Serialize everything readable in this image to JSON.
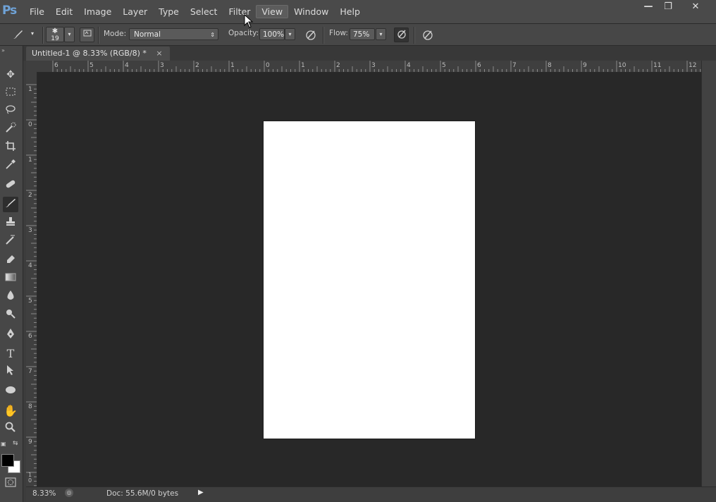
{
  "app": {
    "logo": "Ps"
  },
  "menu": [
    "File",
    "Edit",
    "Image",
    "Layer",
    "Type",
    "Select",
    "Filter",
    "View",
    "Window",
    "Help"
  ],
  "active_menu": "View",
  "window_controls": [
    "—",
    "❐",
    "✕"
  ],
  "options": {
    "brush_size": "19",
    "mode_label": "Mode:",
    "mode_value": "Normal",
    "opacity_label": "Opacity:",
    "opacity_value": "100%",
    "flow_label": "Flow:",
    "flow_value": "75%"
  },
  "document_tab": {
    "title": "Untitled-1 @ 8.33% (RGB/8) *",
    "close": "×"
  },
  "ruler_top_labels": [
    "6",
    "5",
    "4",
    "3",
    "2",
    "1",
    "0",
    "1",
    "2",
    "3",
    "4",
    "5",
    "6",
    "7",
    "8",
    "9",
    "10",
    "11",
    "12"
  ],
  "ruler_left_labels": [
    "1",
    "0",
    "1",
    "2",
    "3",
    "4",
    "5",
    "6",
    "7",
    "8",
    "9",
    "1 0"
  ],
  "status": {
    "zoom": "8.33%",
    "doc_info": "Doc: 55.6M/0 bytes"
  },
  "colors": {
    "foreground": "#000000",
    "background": "#ffffff",
    "canvas_bg": "#282828",
    "document": "#ffffff"
  }
}
